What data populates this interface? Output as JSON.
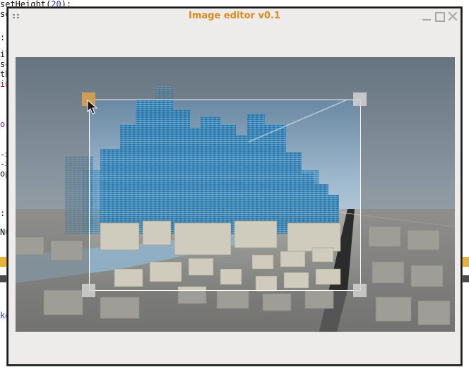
{
  "background_editor": {
    "lines": [
      {
        "text": "setHeight(",
        "num": "20",
        "tail": ");"
      },
      {
        "text": "se"
      },
      {
        "text": "::"
      },
      {
        "text": "il"
      },
      {
        "text": "sc"
      },
      {
        "text": "th"
      },
      {
        "text": "in"
      },
      {
        "text": "or"
      },
      {
        "text": "->"
      },
      {
        "text": "->"
      },
      {
        "text": "op"
      },
      {
        "text": "::"
      },
      {
        "text": "Nu"
      },
      {
        "text": "ke"
      }
    ]
  },
  "window": {
    "title": "Image editor v0.1",
    "controls": {
      "minimize": "minimize-icon",
      "maximize": "maximize-icon",
      "close": "close-icon"
    },
    "accent_color": "#d98a1b"
  },
  "editor": {
    "image_description_icon": "city-skyline-image",
    "crop": {
      "active_handle": "top-left"
    }
  },
  "colors": {
    "window_bg": "#edecea",
    "title": "#d98a1b",
    "crop_border": "#ffffff",
    "handle": "#d2d2d2",
    "handle_active": "#d8a050"
  }
}
